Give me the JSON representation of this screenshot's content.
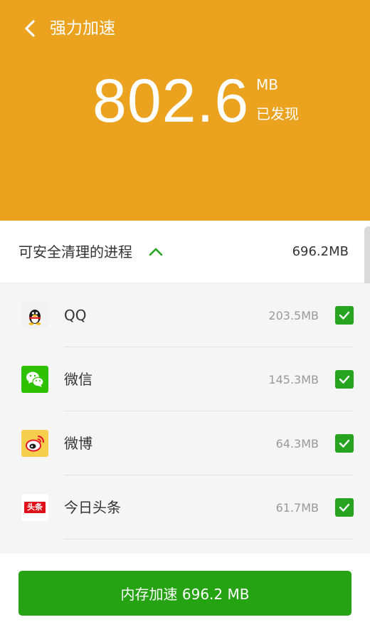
{
  "header": {
    "title": "强力加速",
    "back_icon": "chevron-left-icon",
    "total_value": "802.6",
    "unit": "MB",
    "found_label": "已发现",
    "background_color": "#eba21f"
  },
  "section": {
    "title": "可安全清理的进程",
    "size": "696.2MB",
    "toggle_icon": "chevron-up-icon"
  },
  "apps": [
    {
      "name": "QQ",
      "size": "203.5MB",
      "icon": "qq-icon",
      "checked": true
    },
    {
      "name": "微信",
      "size": "145.3MB",
      "icon": "wechat-icon",
      "checked": true
    },
    {
      "name": "微博",
      "size": "64.3MB",
      "icon": "weibo-icon",
      "checked": true
    },
    {
      "name": "今日头条",
      "size": "61.7MB",
      "icon": "toutiao-icon",
      "checked": true,
      "icon_text": "头条"
    }
  ],
  "footer": {
    "button_label": "内存加速 696.2 MB",
    "accent_color": "#26a313"
  }
}
